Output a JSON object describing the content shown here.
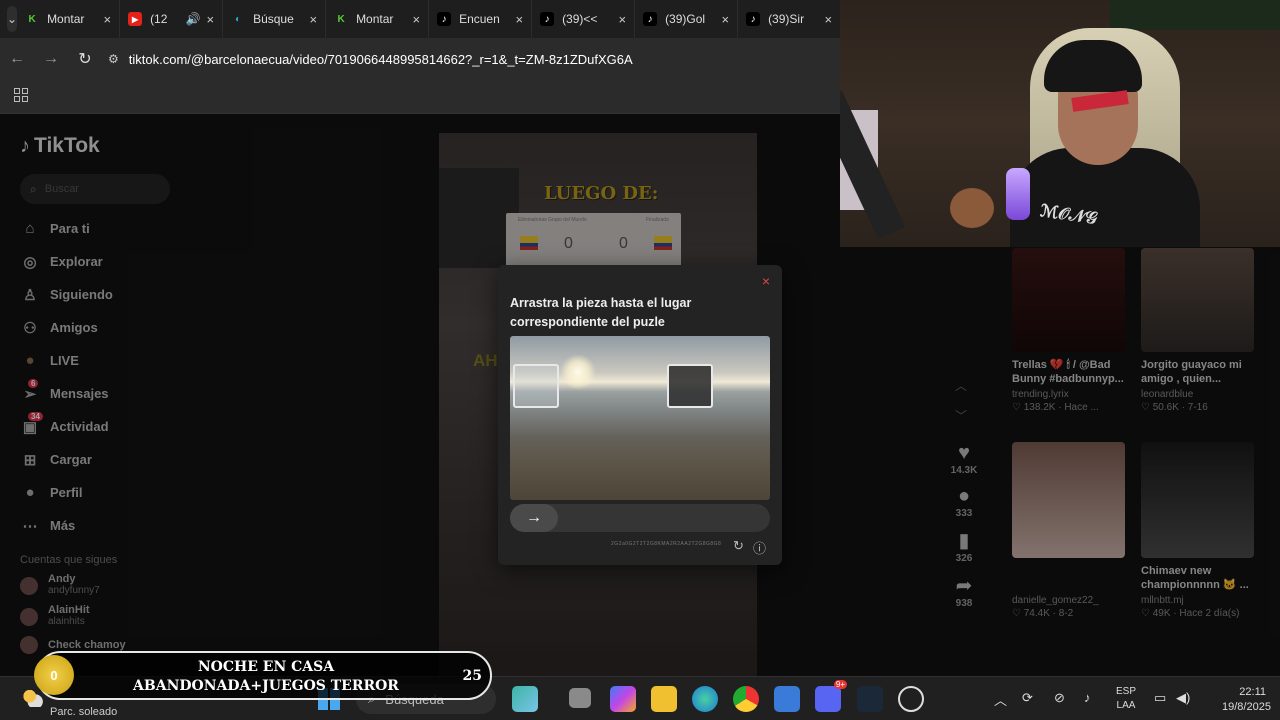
{
  "browser": {
    "tabs": [
      {
        "label": "Montar",
        "icon": "k-logo-icon",
        "color": "#55cc33"
      },
      {
        "label": "(12",
        "icon": "youtube-icon",
        "color": "#e62117"
      },
      {
        "label": "Búsque",
        "icon": "search-engine-icon",
        "color": "#2aa7c9"
      },
      {
        "label": "Montar",
        "icon": "k-logo-icon",
        "color": "#55cc33"
      },
      {
        "label": "Encuen",
        "icon": "tiktok-icon",
        "color": "#ffffff"
      },
      {
        "label": "(39)<<",
        "icon": "tiktok-icon",
        "color": "#ffffff"
      },
      {
        "label": "(39)Gol",
        "icon": "tiktok-icon",
        "color": "#ffffff"
      },
      {
        "label": "(39)Sir",
        "icon": "tiktok-icon",
        "color": "#ffffff"
      }
    ],
    "url": "tiktok.com/@barcelonaecua/video/7019066448995814662?_r=1&_t=ZM-8z1ZDufXG6A"
  },
  "tiktok": {
    "logo": "TikTok",
    "search_placeholder": "Buscar",
    "nav": [
      {
        "label": "Para ti",
        "icon": "home-icon",
        "glyph": "⌂"
      },
      {
        "label": "Explorar",
        "icon": "compass-icon",
        "glyph": "◎"
      },
      {
        "label": "Siguiendo",
        "icon": "person-icon",
        "glyph": "♙"
      },
      {
        "label": "Amigos",
        "icon": "friends-icon",
        "glyph": "⚇"
      },
      {
        "label": "LIVE",
        "icon": "live-icon",
        "glyph": "●"
      },
      {
        "label": "Mensajes",
        "icon": "messages-icon",
        "glyph": "➢",
        "badge": "6"
      },
      {
        "label": "Actividad",
        "icon": "activity-icon",
        "glyph": "▣",
        "badge": "34"
      },
      {
        "label": "Cargar",
        "icon": "upload-icon",
        "glyph": "⊞"
      },
      {
        "label": "Perfil",
        "icon": "profile-icon",
        "glyph": "●"
      },
      {
        "label": "Más",
        "icon": "more-icon",
        "glyph": "⋯"
      }
    ],
    "following_header": "Cuentas que sigues",
    "following": [
      {
        "name": "Andy",
        "handle": "andyfunny7"
      },
      {
        "name": "AlainHit",
        "handle": "alainhits"
      },
      {
        "name": "Check chamoy",
        "handle": ""
      }
    ],
    "video": {
      "overlay_title": "LUEGO DE:",
      "overlay_text2": "AH",
      "score_header": "Eliminatorias Grupo del Mundo",
      "score_right_label": "Finalizado",
      "score_left": "0",
      "score_right": "0"
    },
    "actions": [
      {
        "icon": "heart-icon",
        "glyph": "♥",
        "count": "14.3K"
      },
      {
        "icon": "comment-icon",
        "glyph": "●",
        "count": "333"
      },
      {
        "icon": "bookmark-icon",
        "glyph": "▮",
        "count": "326"
      },
      {
        "icon": "share-icon",
        "glyph": "➦",
        "count": "938"
      }
    ],
    "suggested": [
      {
        "caption": "Trellas 💔 🕯 / @Bad Bunny #badbunnyp...",
        "user": "trending.lyrix",
        "stat": "♡ 138.2K · Hace ..."
      },
      {
        "caption": "Jorgito guayaco mi amigo , quien...",
        "user": "leonardblue",
        "stat": "♡ 50.6K · 7-16"
      },
      {
        "caption": "",
        "user": "danielle_gomez22_",
        "stat": "♡ 74.4K · 8-2"
      },
      {
        "caption": "Chimaev new championnnnn 🐱 ...",
        "user": "mllnbtt.mj",
        "stat": "♡ 49K · Hace 2 día(s)"
      }
    ]
  },
  "captcha": {
    "instruction": "Arrastra la pieza hasta el lugar correspondiente del puzle",
    "close_glyph": "×",
    "slider_glyph": "→",
    "refresh_glyph": "↻",
    "info_glyph": "ⓘ",
    "footer_code": "2G2a0G2T2T2G8KMA2R2AA2T2G8G8G8"
  },
  "stream": {
    "coin": "0",
    "line1": "NOCHE EN CASA",
    "line2": "ABANDONADA+JUEGOS TERROR",
    "count": "25"
  },
  "taskbar": {
    "weather_text": "Parc. soleado",
    "search": "Búsqueda",
    "lang_top": "ESP",
    "lang_bottom": "LAA",
    "time": "22:11",
    "date": "19/8/2025",
    "discord_badge": "9+"
  }
}
